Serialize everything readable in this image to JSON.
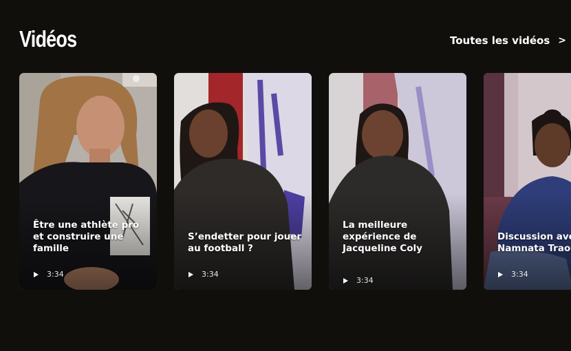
{
  "section": {
    "title": "Vidéos"
  },
  "all_link": {
    "label": "Toutes les vidéos",
    "icon": "chevron-right-icon"
  },
  "videos": [
    {
      "title": "Être une athlète pro et construire une famille",
      "duration": "3:34"
    },
    {
      "title": "S’endetter pour jouer au football ?",
      "duration": "3:34"
    },
    {
      "title": "La meilleure expérience de Jacqueline Coly",
      "duration": "3:34"
    },
    {
      "title": "Discussion avec Namnata Traoré",
      "duration": "3:34"
    }
  ],
  "colors": {
    "background": "#110f0c",
    "text": "#ffffff"
  }
}
